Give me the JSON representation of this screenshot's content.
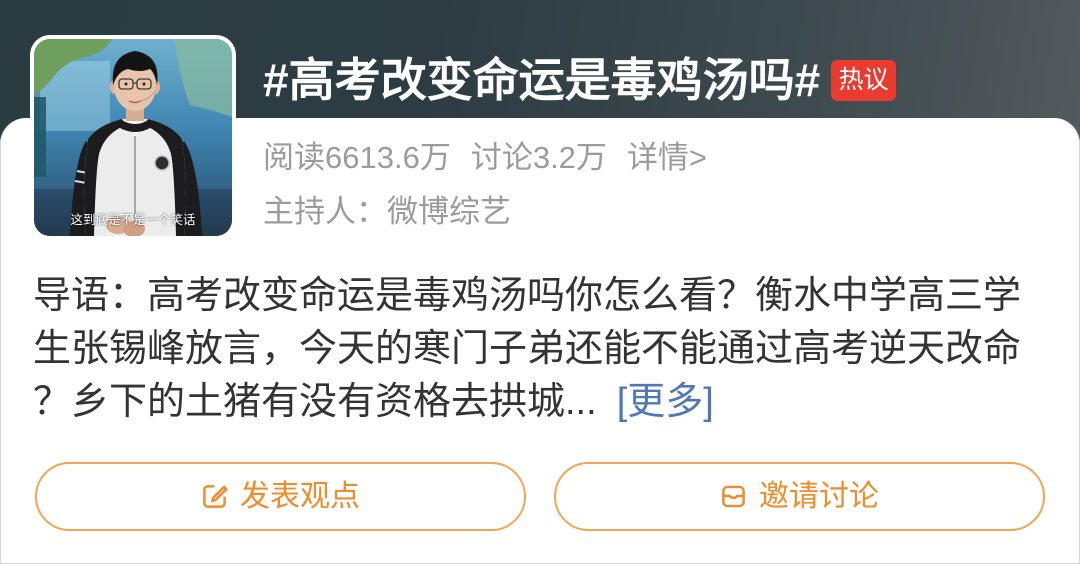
{
  "header": {
    "title": "#高考改变命运是毒鸡汤吗#",
    "badge": "热议"
  },
  "thumbnail": {
    "caption": "这到底是不是一个笑话"
  },
  "stats": {
    "reads": "阅读6613.6万",
    "discussions": "讨论3.2万",
    "details_link": "详情>"
  },
  "host": {
    "label": "主持人：",
    "name": "微博综艺"
  },
  "intro": {
    "lines": [
      "导语：高考改变命运是毒鸡汤吗你怎么看？衡水中学高三学",
      "生张锡峰放言，今天的寒门子弟还能不能通过高考逆天改命",
      "？乡下的土猪有没有资格去拱城..."
    ],
    "more_link": "[更多]"
  },
  "actions": [
    {
      "label": "发表观点",
      "icon": "edit-icon"
    },
    {
      "label": "邀请讨论",
      "icon": "inbox-icon"
    }
  ],
  "colors": {
    "hot_red": "#ea3b30",
    "accent_orange": "#ef8c2b",
    "button_border": "#f2a650",
    "link_blue": "#5078b4",
    "muted_gray": "#9b9b9b",
    "body_text": "#333333"
  }
}
